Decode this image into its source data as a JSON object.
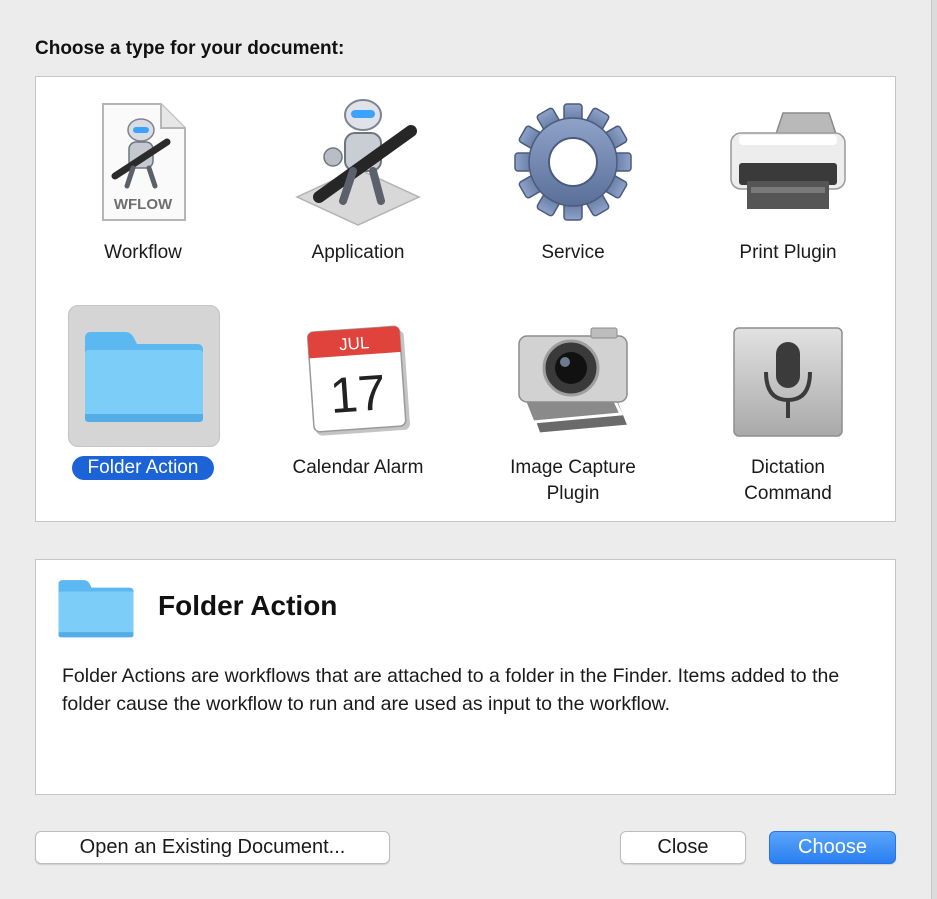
{
  "dialog": {
    "heading": "Choose a type for your document:"
  },
  "types": [
    {
      "label": "Workflow",
      "icon": "wflow-document-icon",
      "icon_text": "WFLOW"
    },
    {
      "label": "Application",
      "icon": "automator-robot-icon"
    },
    {
      "label": "Service",
      "icon": "gear-icon"
    },
    {
      "label": "Print Plugin",
      "icon": "printer-icon"
    },
    {
      "label": "Folder Action",
      "icon": "folder-icon",
      "selected": true
    },
    {
      "label": "Calendar Alarm",
      "icon": "calendar-icon",
      "month": "JUL",
      "day": "17"
    },
    {
      "label": "Image Capture Plugin",
      "icon": "camera-icon"
    },
    {
      "label": "Dictation Command",
      "icon": "microphone-icon"
    }
  ],
  "detail": {
    "title": "Folder Action",
    "icon": "folder-icon",
    "description": "Folder Actions are workflows that are attached to a folder in the Finder. Items added to the folder cause the workflow to run and are used as input to the workflow."
  },
  "buttons": {
    "open_existing": "Open an Existing Document...",
    "close": "Close",
    "choose": "Choose"
  },
  "colors": {
    "selection": "#1b63d6",
    "default_button": "#2a7ef0",
    "folder_blue": "#5cc0f5"
  }
}
